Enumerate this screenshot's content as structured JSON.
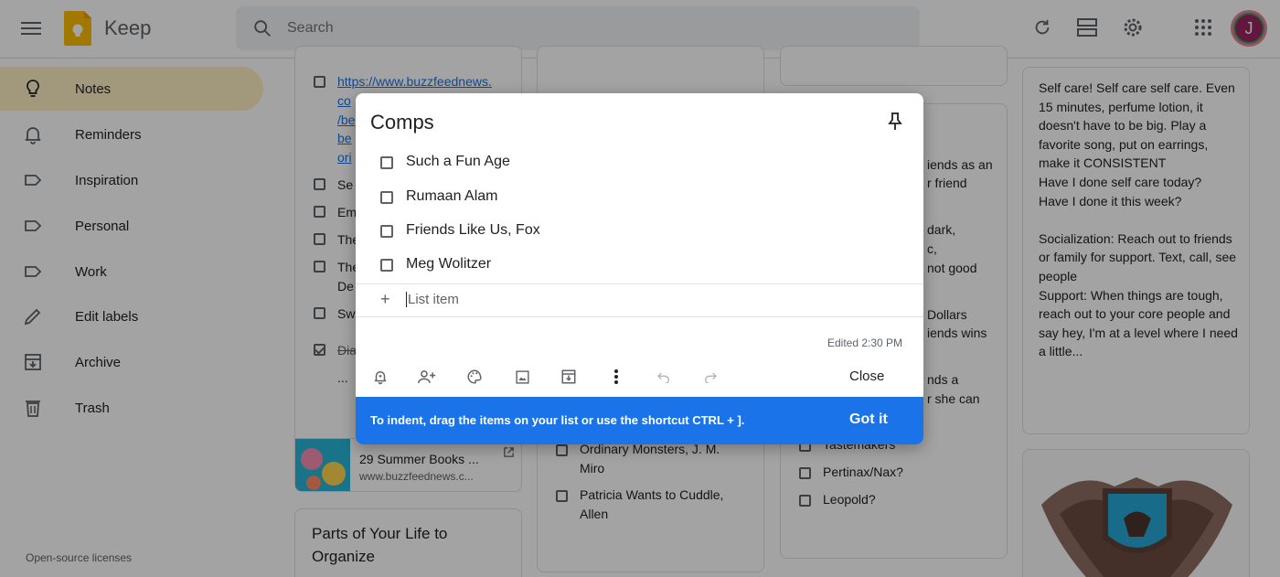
{
  "app": {
    "name": "Keep"
  },
  "search": {
    "placeholder": "Search"
  },
  "sidebar": {
    "items": [
      {
        "label": "Notes",
        "icon": "lightbulb-icon"
      },
      {
        "label": "Reminders",
        "icon": "bell-icon"
      },
      {
        "label": "Inspiration",
        "icon": "label-icon"
      },
      {
        "label": "Personal",
        "icon": "label-icon"
      },
      {
        "label": "Work",
        "icon": "label-icon"
      },
      {
        "label": "Edit labels",
        "icon": "pencil-icon"
      },
      {
        "label": "Archive",
        "icon": "archive-icon"
      },
      {
        "label": "Trash",
        "icon": "trash-icon"
      }
    ],
    "footer": "Open-source licenses"
  },
  "notes": {
    "col1": {
      "link_lines": [
        "https://www.buzzfeednews.",
        "co",
        "/be",
        "be",
        "ori"
      ],
      "items": [
        "Se",
        "Em",
        "The",
        "The",
        "De",
        "Sw",
        "Dia"
      ],
      "ellipsis": "...",
      "link_card": {
        "title": "29 Summer Books ...",
        "url": "www.buzzfeednews.c..."
      },
      "parts_title": "Parts of Your Life to Organize"
    },
    "col2": {
      "items": [
        "Ordinary Monsters, J. M. Miro",
        "Patricia Wants to Cuddle, Allen"
      ]
    },
    "col3": {
      "fragments": [
        "iends as an",
        "r friend",
        "dark,",
        "c,",
        "not good",
        "Dollars",
        "iends wins",
        "nds a",
        "r she can"
      ],
      "items": [
        "Tastemakers",
        "Pertinax/Nax?",
        "Leopold?"
      ]
    },
    "col4": {
      "text": "Self care! Self care self care. Even 15 minutes, perfume lotion, it doesn't have to be big. Play a favorite song, put on earrings, make it CONSISTENT\nHave I done self care today?\nHave I done it this week?\n\nSocialization: Reach out to friends or family for support. Text, call, see people\nSupport: When things are tough, reach out to your core people and say hey, I'm at a level where I need a little..."
    }
  },
  "dialog": {
    "title": "Comps",
    "items": [
      "Such a Fun Age",
      "Rumaan Alam",
      "Friends Like Us, Fox",
      "Meg Wolitzer"
    ],
    "add_placeholder": "List item",
    "edited": "Edited 2:30 PM",
    "close_label": "Close",
    "banner_text": "To indent, drag the items on your list or use the shortcut CTRL + ].",
    "banner_button": "Got it"
  },
  "user": {
    "initial": "J"
  },
  "colors": {
    "accent": "#1a73e8",
    "active_nav": "#feefc3",
    "logo": "#fbbc04",
    "avatar": "#9b2463"
  }
}
